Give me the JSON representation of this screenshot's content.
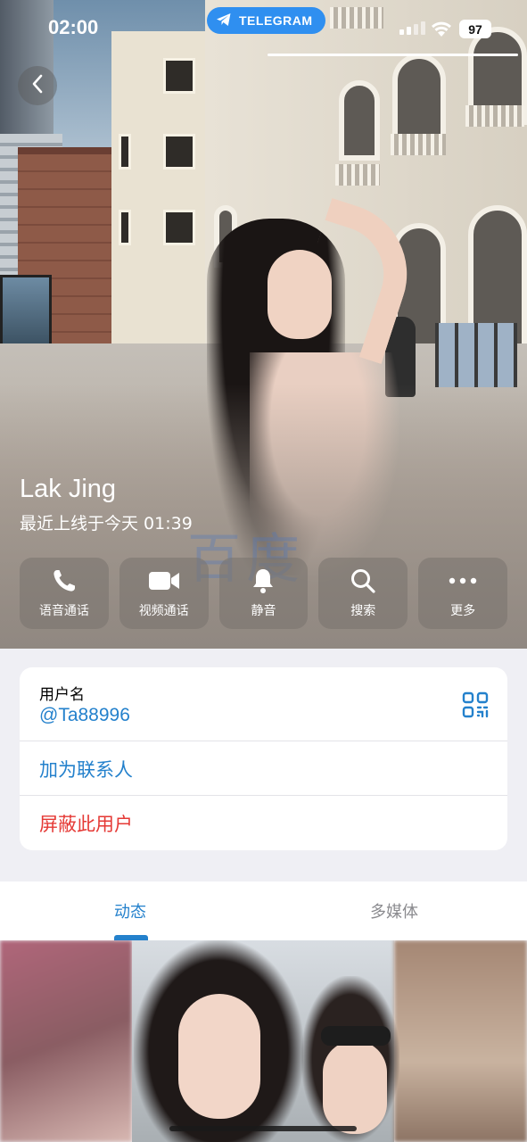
{
  "status_bar": {
    "time": "02:00",
    "app_pill": "TELEGRAM",
    "battery": "97"
  },
  "profile": {
    "name": "Lak Jing",
    "last_seen": "最近上线于今天 01:39"
  },
  "actions": [
    {
      "label": "语音通话",
      "icon": "phone-icon"
    },
    {
      "label": "视频通话",
      "icon": "video-camera-icon"
    },
    {
      "label": "静音",
      "icon": "bell-icon"
    },
    {
      "label": "搜索",
      "icon": "search-icon"
    },
    {
      "label": "更多",
      "icon": "more-dots-icon"
    }
  ],
  "watermark": "百度",
  "info": {
    "username_label": "用户名",
    "username_value": "@Ta88996",
    "add_contact": "加为联系人",
    "block_user": "屏蔽此用户"
  },
  "tabs": {
    "posts": "动态",
    "media": "多媒体"
  },
  "colors": {
    "accent": "#2481cc",
    "danger": "#e53935",
    "telegram_pill": "#2f8ff0"
  }
}
